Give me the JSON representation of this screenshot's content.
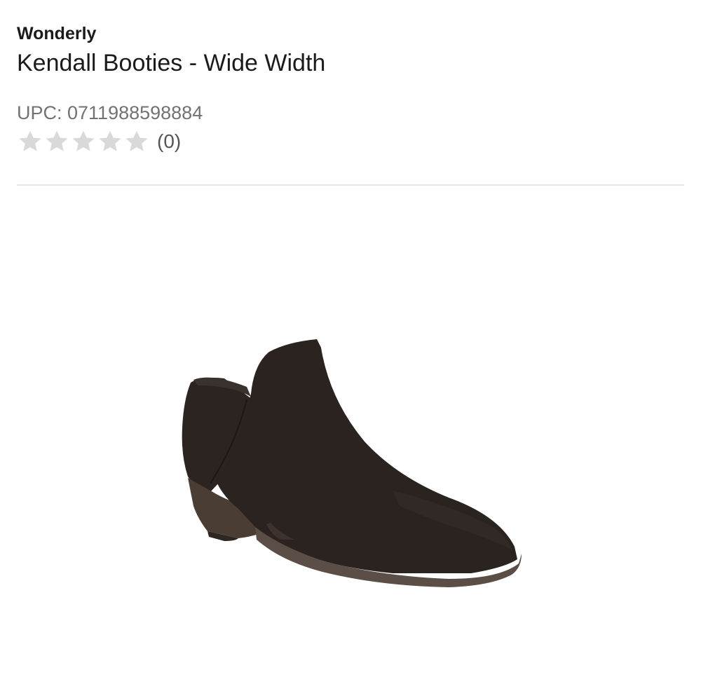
{
  "product": {
    "brand": "Wonderly",
    "title": "Kendall Booties - Wide Width",
    "upc": "UPC: 0711988598884",
    "rating": {
      "stars_filled": 0,
      "stars_total": 5,
      "count_label": "(0)"
    },
    "image": {
      "description_icon": "ankle-bootie-image",
      "color": "#2a2320"
    }
  },
  "colors": {
    "star_empty": "#d9d9d9",
    "divider": "#e5e5e5",
    "secondary_text": "#727272"
  }
}
